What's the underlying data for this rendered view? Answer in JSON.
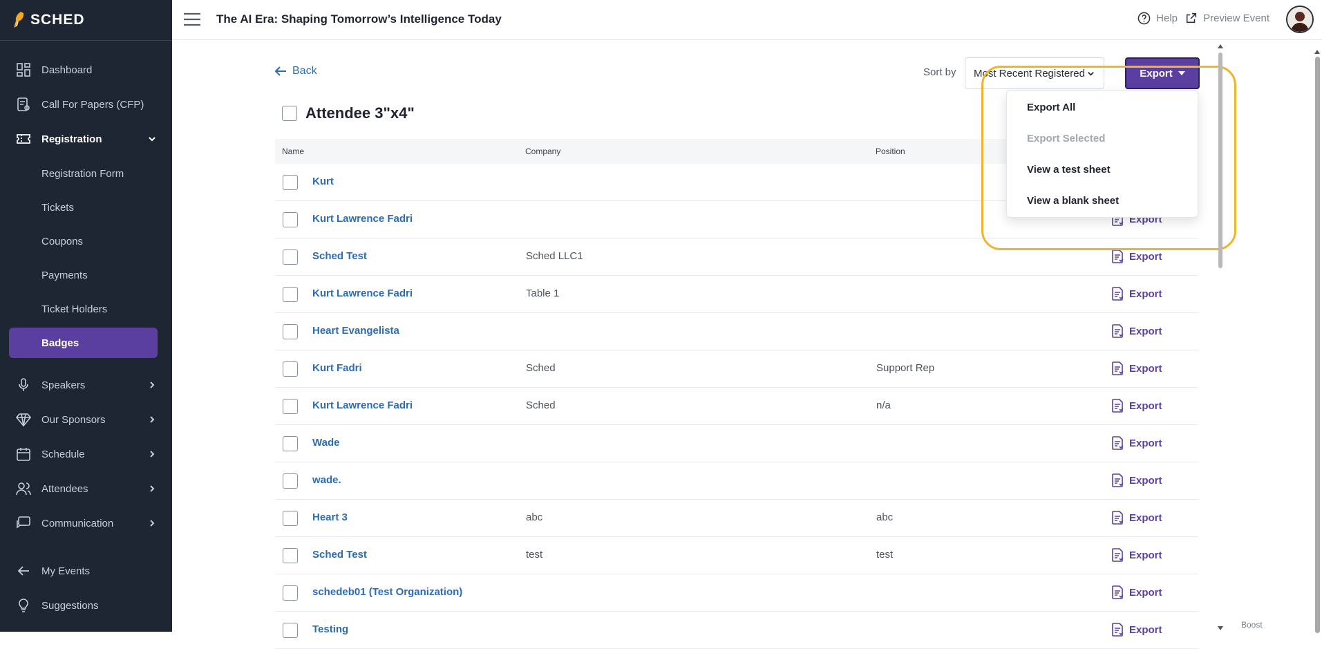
{
  "brand": {
    "name": "SCHED"
  },
  "header": {
    "title": "The AI Era: Shaping Tomorrow’s Intelligence Today",
    "help_label": "Help",
    "preview_label": "Preview Event"
  },
  "sidebar": {
    "items": [
      {
        "label": "Dashboard",
        "icon": "dashboard-icon"
      },
      {
        "label": "Call For Papers (CFP)",
        "icon": "cfp-icon"
      },
      {
        "label": "Registration",
        "icon": "ticket-icon",
        "expanded": true
      },
      {
        "label": "Speakers",
        "icon": "microphone-icon"
      },
      {
        "label": "Our Sponsors",
        "icon": "diamond-icon"
      },
      {
        "label": "Schedule",
        "icon": "calendar-icon"
      },
      {
        "label": "Attendees",
        "icon": "people-icon"
      },
      {
        "label": "Communication",
        "icon": "chat-icon"
      },
      {
        "label": "My Events",
        "icon": "arrow-left-icon"
      },
      {
        "label": "Suggestions",
        "icon": "lightbulb-icon"
      }
    ],
    "registration_sub": [
      {
        "label": "Registration Form"
      },
      {
        "label": "Tickets"
      },
      {
        "label": "Coupons"
      },
      {
        "label": "Payments"
      },
      {
        "label": "Ticket Holders"
      },
      {
        "label": "Badges",
        "active": true
      }
    ]
  },
  "main": {
    "back_label": "Back",
    "sort_label": "Sort by",
    "sort_value": "Most Recent Registered",
    "export_label": "Export",
    "title": "Attendee 3\"x4\"",
    "columns": [
      "Name",
      "Company",
      "Position"
    ],
    "row_export_label": "Export",
    "rows": [
      {
        "name": "Kurt",
        "company": "",
        "position": ""
      },
      {
        "name": "Kurt Lawrence Fadri",
        "company": "",
        "position": ""
      },
      {
        "name": "Sched Test",
        "company": "Sched LLC1",
        "position": ""
      },
      {
        "name": "Kurt Lawrence Fadri",
        "company": "Table 1",
        "position": ""
      },
      {
        "name": "Heart Evangelista",
        "company": "",
        "position": ""
      },
      {
        "name": "Kurt Fadri",
        "company": "Sched",
        "position": "Support Rep"
      },
      {
        "name": "Kurt Lawrence Fadri",
        "company": "Sched",
        "position": "n/a"
      },
      {
        "name": "Wade",
        "company": "",
        "position": ""
      },
      {
        "name": "wade.",
        "company": "",
        "position": ""
      },
      {
        "name": "Heart 3",
        "company": "abc",
        "position": "abc"
      },
      {
        "name": "Sched Test",
        "company": "test",
        "position": "test"
      },
      {
        "name": "schedeb01 (Test Organization)",
        "company": "",
        "position": ""
      },
      {
        "name": "Testing",
        "company": "",
        "position": ""
      }
    ]
  },
  "export_menu": {
    "items": [
      {
        "label": "Export All",
        "disabled": false
      },
      {
        "label": "Export Selected",
        "disabled": true
      },
      {
        "label": "View a test sheet",
        "disabled": false
      },
      {
        "label": "View a blank sheet",
        "disabled": false
      }
    ]
  },
  "footer": {
    "boost_label": "Boost"
  },
  "colors": {
    "sidebar_bg": "#1e2633",
    "accent": "#5a3fa0",
    "link": "#2d6bb3",
    "highlight": "#f0b429"
  }
}
